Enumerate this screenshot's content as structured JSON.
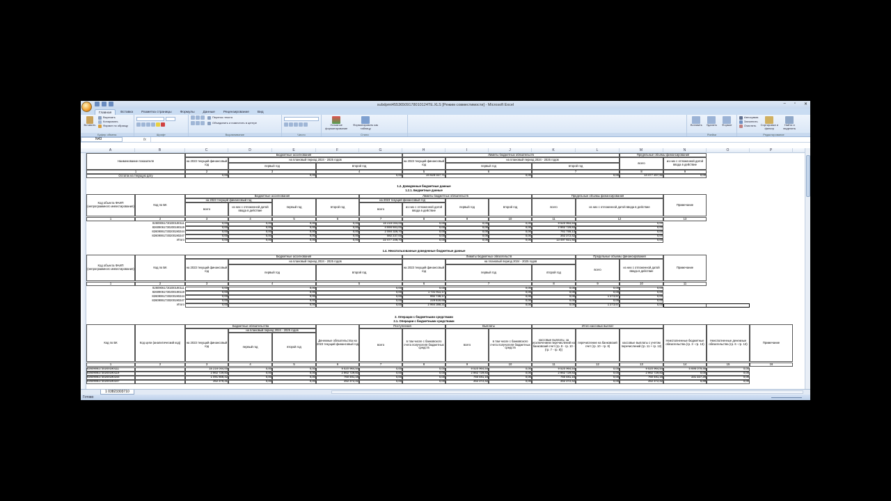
{
  "window": {
    "title": "subdpmt45536509178010124TE.XLS [Режим совместимости] - Microsoft Excel"
  },
  "tabs": [
    "Главная",
    "Вставка",
    "Разметка страницы",
    "Формулы",
    "Данные",
    "Рецензирование",
    "Вид"
  ],
  "ribbon": {
    "clipboard": {
      "paste": "Вставить",
      "cut": "Вырезать",
      "copy": "Копировать",
      "format": "Формат по образцу",
      "label": "Буфер обмена"
    },
    "font": {
      "label": "Шрифт"
    },
    "align": {
      "wrap": "Перенос текста",
      "merge": "Объединить и поместить в центре",
      "label": "Выравнивание"
    },
    "number": {
      "label": "Число"
    },
    "styles": {
      "cond": "Условное форматирование",
      "table": "Форматировать как таблицу",
      "label": "Стили"
    },
    "cells": {
      "insert": "Вставить",
      "delete": "Удалить",
      "format": "Формат",
      "label": "Ячейки"
    },
    "edit": {
      "autosum": "Автосумма",
      "fill": "Заполнить",
      "clear": "Очистить",
      "sort": "Сортировка и фильтр",
      "find": "Найти и выделить",
      "label": "Редактирование"
    }
  },
  "namebox": "N43",
  "columns": [
    "A",
    "B",
    "C",
    "D",
    "E",
    "F",
    "G",
    "H",
    "I",
    "J",
    "K",
    "L",
    "M",
    "N",
    "O",
    "P"
  ],
  "sheet_tab": "1 03823303710",
  "status": "Готово",
  "s1": {
    "title_name": "Наименование показателя",
    "ba": "Бюджетные ассигнования",
    "lbo": "Лимиты бюджетных обязательств",
    "pof": "Предельные объемы финансирования",
    "cur": "на 2023 текущий финансовый год",
    "plan": "на плановый период 2024 - 2025 годов",
    "first": "первый год",
    "second": "второй год",
    "total": "всего",
    "incl": "из них с отложенной датой ввода в действие",
    "nums": [
      "1",
      "2",
      "3",
      "4",
      "5",
      "6",
      "7",
      "8",
      "9"
    ],
    "row_label": "Остаток на текущую дату",
    "row_vals": [
      "0,00",
      "0,00",
      "0,00",
      "24 628 027,71",
      "0,00",
      "0,00",
      "14 477 207,92",
      "0,00"
    ]
  },
  "s2": {
    "h1": "1.2. Доведенные бюджетные данные",
    "h2": "1.2.1. Бюджетные данные",
    "kod_faip": "Код объекта ФАИП (непрограммного инвестирования)",
    "kod_bk": "Код по БК",
    "note": "Примечание",
    "ba": "Бюджетные ассигнования",
    "lbo": "Лимиты бюджетных обязательств",
    "pof": "Предельные объемы финансирования",
    "cur": "на 2023 текущий финансовый год",
    "plan": "на плановый период 2024 - 2025 годов",
    "total": "всего",
    "incl": "из них с отложенной датой ввода в действие",
    "incl2": "из них с отложенной датой ввода в действие",
    "first": "первый год",
    "second": "второй год",
    "nums": [
      "1",
      "2",
      "3",
      "4",
      "5",
      "6",
      "7",
      "8",
      "9",
      "10",
      "11",
      "12",
      "13"
    ],
    "rows": [
      {
        "bk": "82609061730200190111",
        "v": [
          "0,00",
          "0,00",
          "0,00",
          "0,00",
          "15 216 044,00",
          "0,00",
          "0,00",
          "0,00",
          "9 520 964,54",
          "0,00"
        ]
      },
      {
        "bk": "82609061730200190119",
        "v": [
          "0,00",
          "0,00",
          "0,00",
          "0,00",
          "4 594 841,00",
          "0,00",
          "0,00",
          "0,00",
          "2 862 729,83",
          "0,00"
        ]
      },
      {
        "bk": "82609061730200190244",
        "v": [
          "0,00",
          "0,00",
          "0,00",
          "0,00",
          "2 084 326,70",
          "0,00",
          "0,00",
          "0,00",
          "761 755,13",
          "0,00"
        ]
      },
      {
        "bk": "82609061730200190247",
        "v": [
          "0,00",
          "0,00",
          "0,00",
          "0,00",
          "582 237,00",
          "0,00",
          "0,00",
          "0,00",
          "352 372,42",
          "0,00"
        ]
      }
    ],
    "itogo": "Итого",
    "itogo_vals": [
      "0,00",
      "0,00",
      "0,00",
      "0,00",
      "22 477 246,70",
      "0,00",
      "0,00",
      "0,00",
      "13 497 821,92",
      "0,00"
    ]
  },
  "s3": {
    "h1": "1.4. Неиспользованные доведенные бюджетные данные",
    "kod_faip": "Код объекта ФАИП (непрограммного инвестирования)",
    "kod_bk": "Код по БК",
    "note": "Примечание",
    "ba": "Бюджетные ассигнования",
    "lbo": "Лимиты бюджетных обязательств",
    "pof": "Предельные объемы финансирования",
    "cur": "на 2023 текущий финансовый год",
    "plan": "на плановый период 2024 - 2025 годов",
    "first": "первый год",
    "second": "второй год",
    "total": "всего",
    "incl": "из них с отложенной датой ввода в действие",
    "nums": [
      "1",
      "2",
      "3",
      "4",
      "5",
      "6",
      "7",
      "8",
      "9",
      "10",
      "11"
    ],
    "rows": [
      {
        "bk": "82609061730200190111",
        "v": [
          "0,00",
          "0,00",
          "0,00",
          "0,00",
          "0,00",
          "0,00",
          "0,00",
          "0,00"
        ]
      },
      {
        "bk": "82609061730200190119",
        "v": [
          "0,00",
          "0,00",
          "0,00",
          "1 731 911,17",
          "0,00",
          "0,00",
          "0,00",
          "0,00"
        ]
      },
      {
        "bk": "82609061730200190244",
        "v": [
          "0,00",
          "0,00",
          "0,00",
          "992 736,17",
          "0,00",
          "0,00",
          "1 273,67",
          "0,00"
        ]
      },
      {
        "bk": "82609061730200190247",
        "v": [
          "0,00",
          "0,00",
          "0,00",
          "229 828,69",
          "0,00",
          "0,00",
          "0,00",
          "0,00"
        ]
      }
    ],
    "itogo": "Итого",
    "itogo_vals": [
      "0,00",
      "0,00",
      "0,00",
      "2 954 388,21",
      "0,00",
      "0,00",
      "1 273,67",
      "0,00"
    ]
  },
  "s4": {
    "h1": "2. Операции с бюджетными средствами",
    "h2": "2.1. Операции с бюджетными средствами",
    "kod_bk": "Код по БК",
    "kod_an": "Код цели (аналитический код)",
    "bo": "Бюджетные обязательства",
    "bo_plan": "на плановый период 2024 - 2025 годов",
    "cur": "на 2023 текущий финансовый год",
    "first": "первый год",
    "second": "второй год",
    "deneg": "Денежные обязательства на 2023 текущий финансовый год",
    "post": "Поступления",
    "vypl": "Выплаты",
    "itogo_kv": "Итого кассовых выплат",
    "total": "всего",
    "incl_bank": "в том числе с банковского счета получателя бюджетных средств",
    "incl_bank2": "в том числе с банковского счета получателя бюджетных средств",
    "kv_nopay": "кассовые выплаты, за исключением перечислений на банковский счет (гр. 8 - гр. 10 - (гр. 7 - гр. 8))",
    "perech": "перечисление на банковский счет (гр. 10 - гр. 8)",
    "kv_with": "кассовые выплаты с учетом перечислений (гр. 11 + гр. 12)",
    "neisp_bo": "Неисполненные бюджетные обязательства (гр. 3 - гр. 13)",
    "neisp_do": "Неисполненные денежные обязательства (гр. 6 - гр. 13)",
    "note": "Примечание",
    "nums": [
      "1",
      "2",
      "3",
      "4",
      "5",
      "6",
      "7",
      "8",
      "9",
      "10",
      "11",
      "12",
      "13",
      "14",
      "15",
      "16"
    ],
    "rows": [
      {
        "bk": "82609061730200190111",
        "v": [
          "15 216 044,00",
          "0,00",
          "0,00",
          "9 520 964,54",
          "0,00",
          "0,00",
          "9 520 964,54",
          "0,00",
          "9 520 964,54",
          "0,00",
          "9 520 964,54",
          "5 695 079,46",
          "0,00"
        ]
      },
      {
        "bk": "82609061730200190119",
        "v": [
          "2 862 729,83",
          "0,00",
          "0,00",
          "2 862 729,83",
          "0,00",
          "0,00",
          "2 862 729,83",
          "0,00",
          "2 862 729,83",
          "0,00",
          "2 862 729,83",
          "0,00",
          "0,00"
        ]
      },
      {
        "bk": "82609061730200190244",
        "v": [
          "1 091 808,42",
          "0,00",
          "0,00",
          "760 481,16",
          "0,00",
          "0,00",
          "760 481,16",
          "0,00",
          "760 481,16",
          "0,00",
          "760 481,16",
          "331 327,26",
          "0,00"
        ]
      },
      {
        "bk": "82609061730200190247",
        "v": [
          "352 378,31",
          "0,00",
          "0,00",
          "352 372,42",
          "0,00",
          "0,00",
          "352 372,42",
          "0,00",
          "352 372,42",
          "0,00",
          "352 372,42",
          "5,89",
          "0,00"
        ]
      }
    ]
  }
}
